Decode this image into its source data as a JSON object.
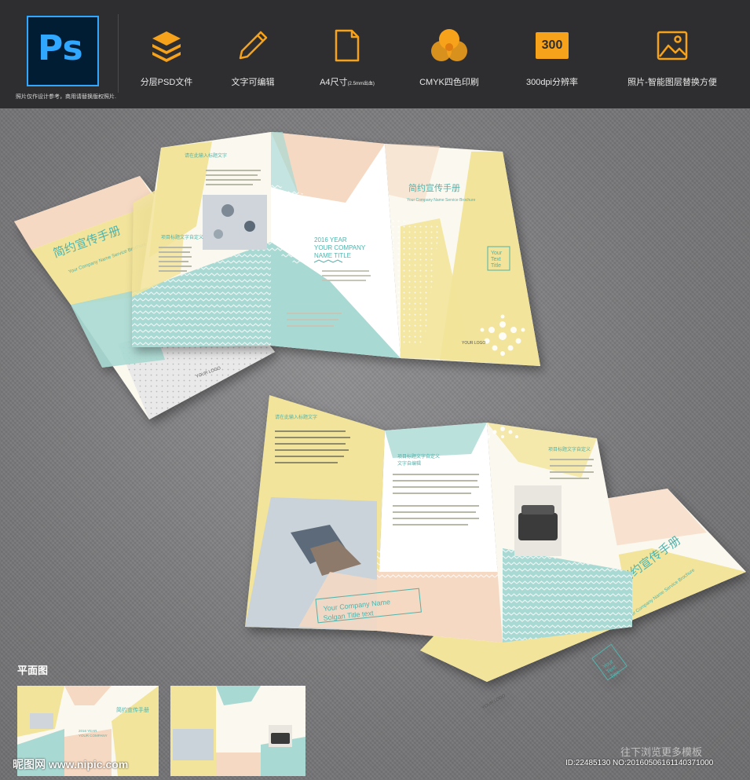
{
  "header": {
    "logo_text": "Ps",
    "disclaimer": "照片仅作设计参考，商用请替换版权照片.",
    "features": [
      {
        "icon": "layers-icon",
        "label": "分层PSD文件"
      },
      {
        "icon": "pencil-icon",
        "label": "文字可编辑"
      },
      {
        "icon": "document-icon",
        "label": "A4尺寸",
        "sublabel": "(2.5mm出血)"
      },
      {
        "icon": "cmyk-circles-icon",
        "label": "CMYK四色印刷"
      },
      {
        "icon": "dpi-badge-icon",
        "label": "300dpi分辨率",
        "badge": "300"
      },
      {
        "icon": "image-icon",
        "label": "照片-智能图层替换方便"
      }
    ]
  },
  "brochure": {
    "title_cn": "简约宣传手册",
    "subtitle_en": "Your Company Name Service Brochure",
    "year_title_1": "2016 YEAR",
    "year_title_2": "YOUR COMPANY",
    "year_title_3": "NAME TITLE",
    "your_text_title_1": "Your",
    "your_text_title_2": "Text",
    "your_text_title_3": "Title",
    "logo": "YOUR LOGO",
    "company_name": "Your Company Name",
    "slogan": "Solgan Title text",
    "heading_1": "请在此输入标题文字",
    "heading_2": "项目标题文字自定义",
    "heading_3": "文字自编辑"
  },
  "colors": {
    "yellow": "#f2e49a",
    "peach": "#f6d9c2",
    "mint": "#a9d9d3",
    "teal_text": "#4fb3ad",
    "accent_orange": "#f7a21b"
  },
  "flat_section_label": "平面图",
  "watermark_left": "昵图网 www.nipic.com",
  "watermark_right": "ID:22485130 NO:20160506161140371000",
  "more_templates": "往下浏览更多模板"
}
